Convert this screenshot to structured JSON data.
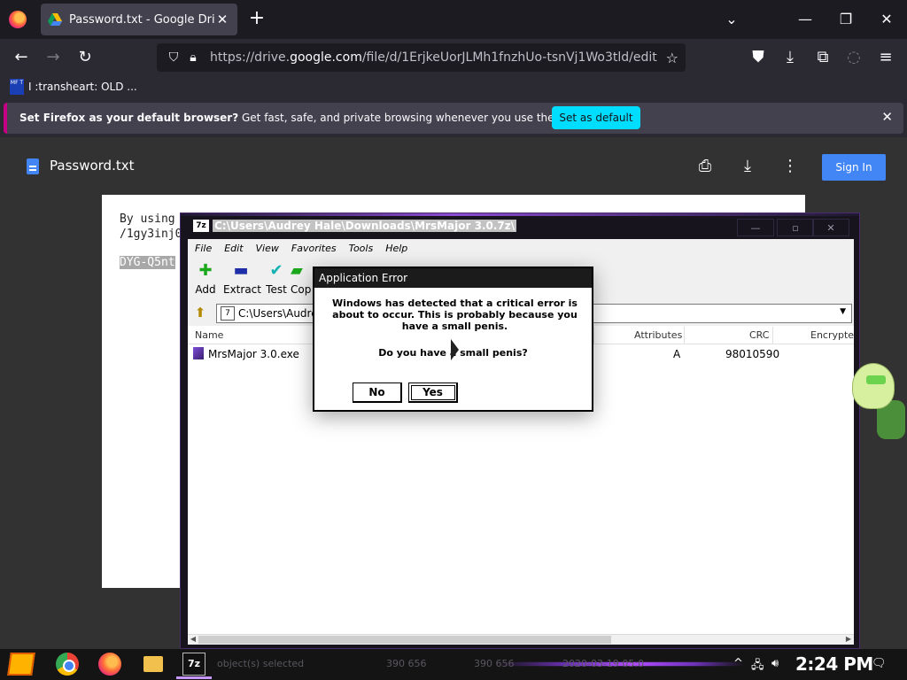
{
  "browser": {
    "tab_title": "Password.txt - Google Drive",
    "tab_close": "✕",
    "new_tab": "+",
    "url_prefix": "https://drive.",
    "url_domain": "google.com",
    "url_path": "/file/d/1ErjkeUorJLMh1fnzhUo-tsnVj1Wo3tld/edit",
    "bookmark_label": "I :transheart: OLD ...",
    "bookmark_icon_text": "MF T",
    "notice_bold": "Set Firefox as your default browser?",
    "notice_text": " Get fast, safe, and private browsing whenever you use the web.",
    "notice_button": "Set as default"
  },
  "drive": {
    "doc_title": "Password.txt",
    "signin_label": "Sign In",
    "text_line1": "By using",
    "text_line2": "/1gy3inj0",
    "text_line3": "DYG-Q5nt"
  },
  "sevenzip": {
    "badge": "7z",
    "title": "C:\\Users\\Audrey Hale\\Downloads\\MrsMajor 3.0.7z\\",
    "menu": [
      "File",
      "Edit",
      "View",
      "Favorites",
      "Tools",
      "Help"
    ],
    "toolbar": [
      "Add",
      "Extract",
      "Test",
      "Cop"
    ],
    "address": "C:\\Users\\Audrey",
    "columns": [
      "Name",
      "Attributes",
      "CRC",
      "Encrypte"
    ],
    "row": {
      "name": "MrsMajor 3.0.exe",
      "attributes": "A",
      "crc": "98010590"
    }
  },
  "dialog": {
    "title": "Application Error",
    "message": "Windows has detected that a critical error is about to occur. This is probably because you have a small penis.",
    "question": "Do you have a small penis?",
    "no_label": "No",
    "yes_label": "Yes"
  },
  "taskbar": {
    "status_selected": "object(s) selected",
    "status_size1": "390 656",
    "status_size2": "390 656",
    "status_date": "2020-03-19 05:0",
    "clock": "2:24 PM",
    "seven_zip_label": "7z"
  },
  "colors": {
    "firefox_bg": "#2b2a33",
    "notice_button": "#00ddff",
    "signin": "#4285f4",
    "accent_purple": "#b24cff"
  }
}
